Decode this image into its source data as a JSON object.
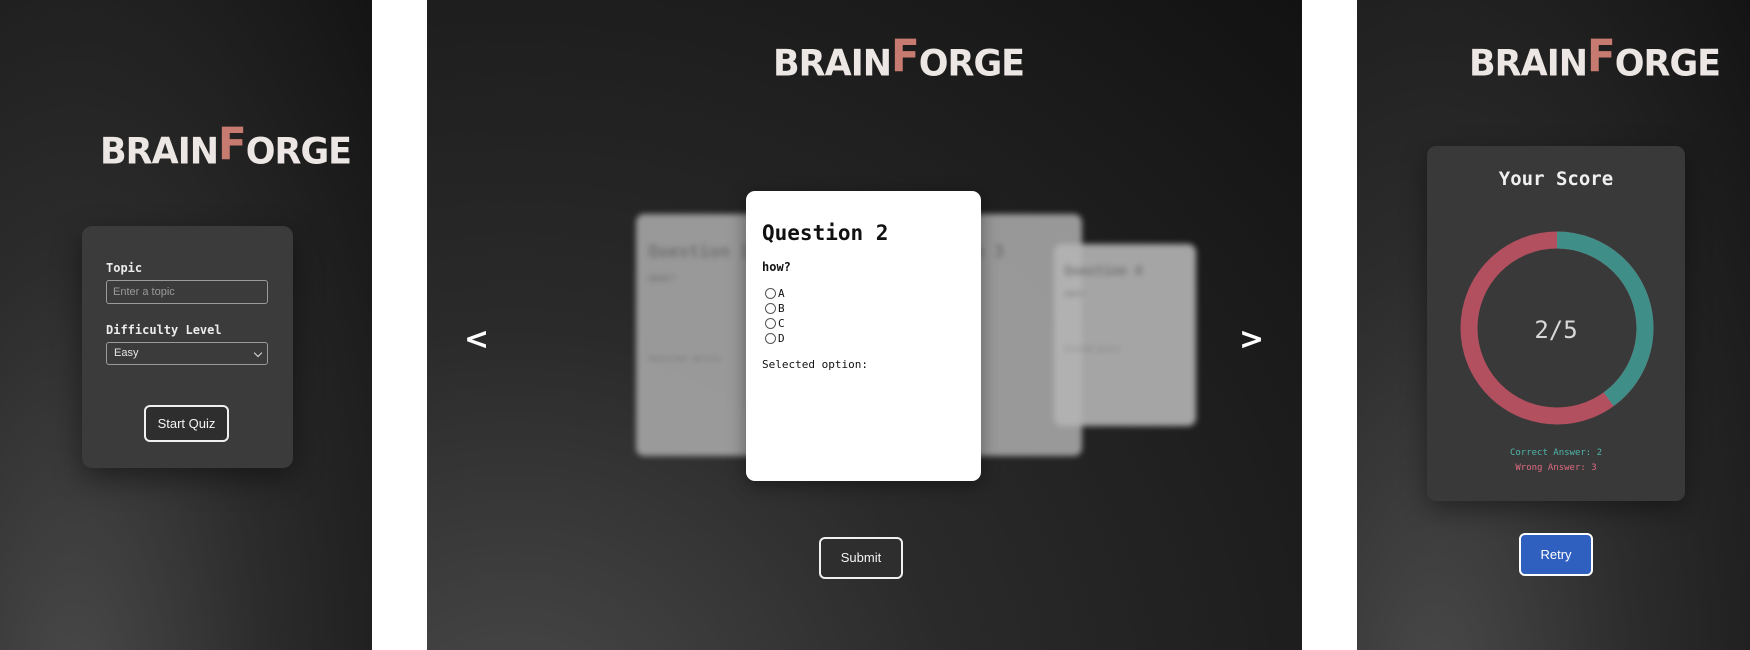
{
  "brand": {
    "prefix": "BRAIN",
    "accent": "F",
    "suffix": "ORGE",
    "accent_color": "#c77a6f"
  },
  "setup": {
    "topic_label": "Topic",
    "topic_placeholder": "Enter a topic",
    "difficulty_label": "Difficulty Level",
    "difficulty_value": "Easy",
    "start_label": "Start Quiz"
  },
  "quiz": {
    "prev_label": "<",
    "next_label": ">",
    "background_cards": [
      {
        "title": "Question 1",
        "question": "what?",
        "selected": "Selected option:"
      },
      {
        "title": "Question 3"
      },
      {
        "title": "Question 4",
        "question": "what?",
        "selected": "Selected option:"
      }
    ],
    "current": {
      "title": "Question 2",
      "question": "how?",
      "options": [
        "A",
        "B",
        "C",
        "D"
      ],
      "selected_label": "Selected option:"
    },
    "submit_label": "Submit"
  },
  "results": {
    "title": "Your Score",
    "score_text": "2/5",
    "correct": 2,
    "total": 5,
    "correct_text": "Correct Answer: 2",
    "wrong_text": "Wrong Answer: 3",
    "correct_color": "#3f8f88",
    "wrong_color": "#b2505f",
    "retry_label": "Retry"
  }
}
